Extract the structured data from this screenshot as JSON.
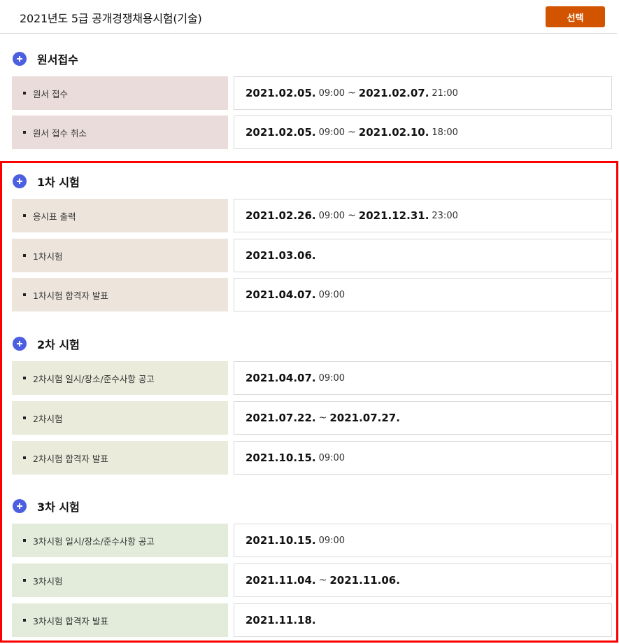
{
  "header": {
    "title": "2021년도 5급 공개경쟁채용시험(기술)",
    "select_label": "선택"
  },
  "colors": {
    "accent": "#d35400",
    "plus_icon": "#4b5fe0",
    "highlight": "#ff0000"
  },
  "sections": [
    {
      "title": "원서접수",
      "rows": [
        {
          "label": "원서 접수",
          "d1": "2021.02.05.",
          "t1": "09:00",
          "sep": "~",
          "d2": "2021.02.07.",
          "t2": "21:00"
        },
        {
          "label": "원서 접수 취소",
          "d1": "2021.02.05.",
          "t1": "09:00",
          "sep": "~",
          "d2": "2021.02.10.",
          "t2": "18:00"
        }
      ]
    },
    {
      "title": "1차 시험",
      "rows": [
        {
          "label": "응시표 출력",
          "d1": "2021.02.26.",
          "t1": "09:00",
          "sep": "~",
          "d2": "2021.12.31.",
          "t2": "23:00"
        },
        {
          "label": "1차시험",
          "d1": "2021.03.06."
        },
        {
          "label": "1차시험 합격자 발표",
          "d1": "2021.04.07.",
          "t1": "09:00"
        }
      ]
    },
    {
      "title": "2차 시험",
      "rows": [
        {
          "label": "2차시험 일시/장소/준수사항 공고",
          "d1": "2021.04.07.",
          "t1": "09:00"
        },
        {
          "label": "2차시험",
          "d1": "2021.07.22.",
          "sep": "~",
          "d2": "2021.07.27."
        },
        {
          "label": "2차시험 합격자 발표",
          "d1": "2021.10.15.",
          "t1": "09:00"
        }
      ]
    },
    {
      "title": "3차 시험",
      "rows": [
        {
          "label": "3차시험 일시/장소/준수사항 공고",
          "d1": "2021.10.15.",
          "t1": "09:00"
        },
        {
          "label": "3차시험",
          "d1": "2021.11.04.",
          "sep": "~",
          "d2": "2021.11.06."
        },
        {
          "label": "3차시험 합격자 발표",
          "d1": "2021.11.18."
        }
      ]
    }
  ]
}
